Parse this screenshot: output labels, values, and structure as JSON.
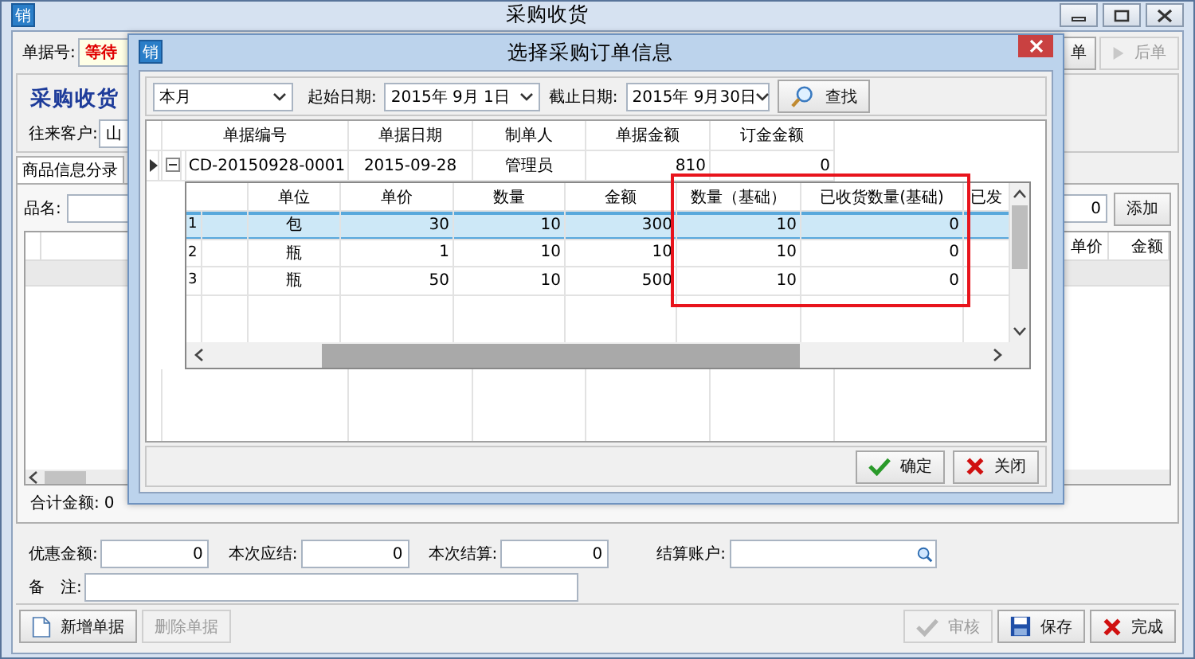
{
  "main": {
    "icon_glyph": "销",
    "title": "采购收货",
    "doc_label": "单据号:",
    "doc_value": "等待",
    "nav_buttons": [
      {
        "label": "单",
        "kind": "previous",
        "disabled": false
      },
      {
        "label": "后单",
        "kind": "next",
        "disabled": true
      }
    ],
    "heading": "采购收货",
    "customer_label": "往来客户:",
    "customer_value": "山",
    "tabs": [
      {
        "label": "商品信息分录",
        "selected": true
      }
    ],
    "product_label": "品名:",
    "count_value": "0",
    "add_button": "添加",
    "grid_columns": [
      "单价",
      "金额"
    ],
    "total_label": "合计金额:",
    "total_value": "0",
    "amount_fields": [
      {
        "label": "优惠金额:",
        "value": "0"
      },
      {
        "label": "本次应结:",
        "value": "0"
      },
      {
        "label": "本次结算:",
        "value": "0"
      }
    ],
    "account_label": "结算账户:",
    "remark_label": "备　注:",
    "left_buttons": [
      {
        "label": "新增单据",
        "kind": "new",
        "disabled": false
      },
      {
        "label": "删除单据",
        "kind": "delete",
        "disabled": true
      }
    ],
    "right_buttons": [
      {
        "label": "审核",
        "kind": "approve",
        "disabled": true
      },
      {
        "label": "保存",
        "kind": "save",
        "disabled": false
      },
      {
        "label": "完成",
        "kind": "finish",
        "disabled": false
      }
    ]
  },
  "dialog": {
    "icon_glyph": "销",
    "title": "选择采购订单信息",
    "period": "本月",
    "start_label": "起始日期:",
    "start_date": "2015年 9月 1日",
    "end_label": "截止日期:",
    "end_date": "2015年 9月30日",
    "search_button": "查找",
    "columns": [
      "单据编号",
      "单据日期",
      "制单人",
      "单据金额",
      "订金金额"
    ],
    "orders": [
      {
        "selected": true,
        "expanded": true,
        "cells": [
          "CD-20150928-0001",
          "2015-09-28",
          "管理员",
          "810",
          "0"
        ],
        "detail": {
          "columns": [
            {
              "label": "单位",
              "kind": "text",
              "highlighted": false
            },
            {
              "label": "单价",
              "kind": "number",
              "highlighted": false
            },
            {
              "label": "数量",
              "kind": "number",
              "highlighted": false
            },
            {
              "label": "金额",
              "kind": "number",
              "highlighted": false
            },
            {
              "label": "数量（基础）",
              "kind": "number",
              "highlighted": true
            },
            {
              "label": "已收货数量(基础)",
              "kind": "number",
              "highlighted": true
            },
            {
              "label": "已发",
              "kind": "number",
              "highlighted": false
            }
          ],
          "rows": [
            {
              "no": "1",
              "selected": true,
              "cells": [
                "包",
                "30",
                "10",
                "300",
                "10",
                "0"
              ]
            },
            {
              "no": "2",
              "selected": false,
              "cells": [
                "瓶",
                "1",
                "10",
                "10",
                "10",
                "0"
              ]
            },
            {
              "no": "3",
              "selected": false,
              "cells": [
                "瓶",
                "50",
                "10",
                "500",
                "10",
                "0"
              ]
            }
          ]
        }
      }
    ],
    "buttons": [
      {
        "label": "确定",
        "kind": "confirm"
      },
      {
        "label": "关闭",
        "kind": "close"
      }
    ]
  }
}
